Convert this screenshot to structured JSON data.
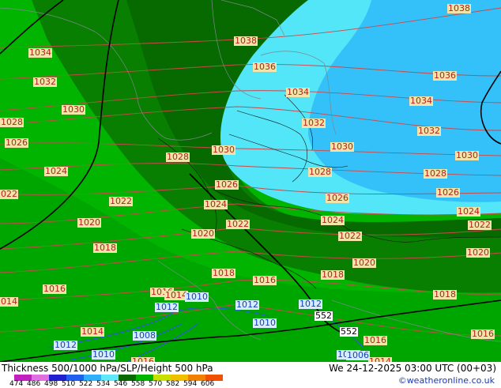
{
  "colors": {
    "t546": "#00b400",
    "t552": "#009a00",
    "t540": "#087f00",
    "t534": "#066a00",
    "t522": "#52e6f8",
    "t516": "#34c0f8",
    "isobar": "#c84a4a",
    "coast": "#7a8a8a",
    "border": "#111111",
    "height": "#000000"
  },
  "isobar_labels": [
    {
      "text": "1038",
      "type": "red"
    },
    {
      "text": "1038",
      "type": "red"
    },
    {
      "text": "1034",
      "type": "red"
    },
    {
      "text": "1036",
      "type": "red"
    },
    {
      "text": "1032",
      "type": "red"
    },
    {
      "text": "1036",
      "type": "red"
    },
    {
      "text": "1034",
      "type": "red"
    },
    {
      "text": "1030",
      "type": "red"
    },
    {
      "text": "1034",
      "type": "red"
    },
    {
      "text": "1028",
      "type": "red"
    },
    {
      "text": "1032",
      "type": "red"
    },
    {
      "text": "1032",
      "type": "red"
    },
    {
      "text": "1026",
      "type": "red"
    },
    {
      "text": "1030",
      "type": "red"
    },
    {
      "text": "1030",
      "type": "red"
    },
    {
      "text": "1030",
      "type": "red"
    },
    {
      "text": "1028",
      "type": "red"
    },
    {
      "text": "1024",
      "type": "red"
    },
    {
      "text": "1028",
      "type": "red"
    },
    {
      "text": "1028",
      "type": "red"
    },
    {
      "text": "1026",
      "type": "red"
    },
    {
      "text": "022",
      "type": "red"
    },
    {
      "text": "1026",
      "type": "red"
    },
    {
      "text": "1026",
      "type": "red"
    },
    {
      "text": "1022",
      "type": "red"
    },
    {
      "text": "1024",
      "type": "red"
    },
    {
      "text": "1024",
      "type": "red"
    },
    {
      "text": "1020",
      "type": "red"
    },
    {
      "text": "1024",
      "type": "red"
    },
    {
      "text": "1022",
      "type": "red"
    },
    {
      "text": "1020",
      "type": "red"
    },
    {
      "text": "1022",
      "type": "red"
    },
    {
      "text": "1022",
      "type": "red"
    },
    {
      "text": "1018",
      "type": "red"
    },
    {
      "text": "1020",
      "type": "red"
    },
    {
      "text": "1020",
      "type": "red"
    },
    {
      "text": "1018",
      "type": "red"
    },
    {
      "text": "1016",
      "type": "red"
    },
    {
      "text": "1018",
      "type": "red"
    },
    {
      "text": "1016",
      "type": "red"
    },
    {
      "text": "014",
      "type": "red"
    },
    {
      "text": "1016",
      "type": "red"
    },
    {
      "text": "1014",
      "type": "red"
    },
    {
      "text": "1010",
      "type": "blue"
    },
    {
      "text": "1018",
      "type": "red"
    },
    {
      "text": "1012",
      "type": "blue"
    },
    {
      "text": "1012",
      "type": "blue"
    },
    {
      "text": "1012",
      "type": "blue"
    },
    {
      "text": "552",
      "type": "black"
    },
    {
      "text": "1014",
      "type": "red"
    },
    {
      "text": "1010",
      "type": "blue"
    },
    {
      "text": "1008",
      "type": "blue"
    },
    {
      "text": "552",
      "type": "black"
    },
    {
      "text": "1016",
      "type": "red"
    },
    {
      "text": "1012",
      "type": "blue"
    },
    {
      "text": "1010",
      "type": "blue"
    },
    {
      "text": "1008",
      "type": "blue"
    },
    {
      "text": "1016",
      "type": "red"
    },
    {
      "text": "1016",
      "type": "red"
    },
    {
      "text": "1014",
      "type": "red"
    },
    {
      "text": "1006",
      "type": "blue"
    }
  ],
  "footer": {
    "title": "Thickness 500/1000 hPa/SLP/Height 500 hPa",
    "timestamp": "We 24-12-2025 03:00 UTC (00+03)",
    "credit": "©weatheronline.co.uk"
  },
  "scale": {
    "labels": [
      "474",
      "486",
      "498",
      "510",
      "522",
      "534",
      "546",
      "558",
      "570",
      "582",
      "594",
      "606"
    ],
    "colors": [
      "#c020c0",
      "#e070e0",
      "#2020d0",
      "#2060f0",
      "#30b0f8",
      "#60e8f8",
      "#066a00",
      "#00b400",
      "#c8e000",
      "#f0c000",
      "#f08000",
      "#f05000"
    ]
  }
}
